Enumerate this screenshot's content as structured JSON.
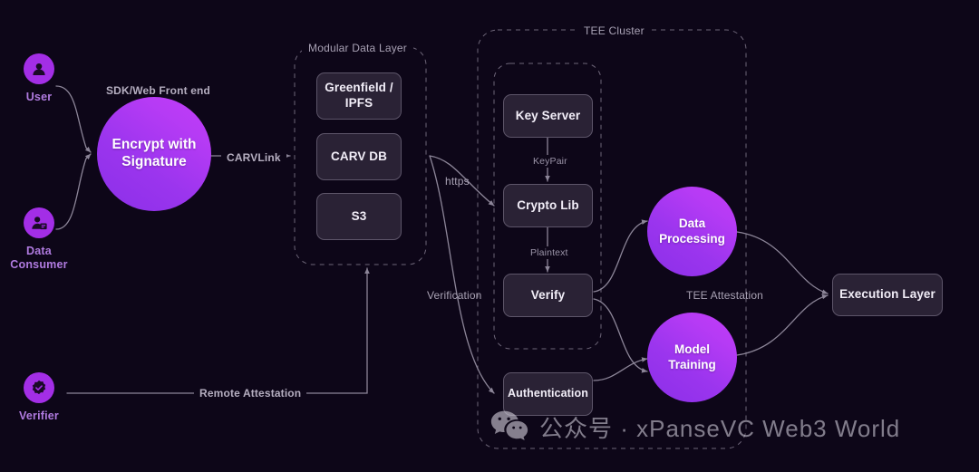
{
  "diagram": {
    "background_color": "#0d0618",
    "accent_color": "#a32ee6",
    "box_fill": "#2a2235",
    "box_border": "#5d5569",
    "edge_color": "#8c8598"
  },
  "actors": [
    {
      "id": "user",
      "label": "User",
      "icon": "user-icon"
    },
    {
      "id": "data_consumer",
      "label": "Data\nConsumer",
      "icon": "data-consumer-icon"
    },
    {
      "id": "verifier",
      "label": "Verifier",
      "icon": "verified-badge-icon"
    }
  ],
  "circles": [
    {
      "id": "encrypt",
      "label": "Encrypt with\nSignature"
    },
    {
      "id": "data_processing",
      "label": "Data\nProcessing"
    },
    {
      "id": "model_training",
      "label": "Model\nTraining"
    }
  ],
  "groups": [
    {
      "id": "modular_data_layer",
      "title": "Modular Data Layer"
    },
    {
      "id": "tee_cluster",
      "title": "TEE Cluster"
    }
  ],
  "modular_data_layer": {
    "title": "Modular Data Layer",
    "nodes": [
      {
        "id": "greenfield",
        "label": "Greenfield /\nIPFS"
      },
      {
        "id": "carvdb",
        "label": "CARV DB"
      },
      {
        "id": "s3",
        "label": "S3"
      }
    ]
  },
  "tee_cluster": {
    "title": "TEE Cluster",
    "inner_nodes": [
      {
        "id": "key_server",
        "label": "Key Server"
      },
      {
        "id": "crypto_lib",
        "label": "Crypto Lib"
      },
      {
        "id": "verify",
        "label": "Verify"
      }
    ],
    "outer_nodes": [
      {
        "id": "authentication",
        "label": "Authentication"
      }
    ]
  },
  "execution": {
    "id": "execution_layer",
    "label": "Execution Layer"
  },
  "edge_labels": {
    "sdk_web_front_end": "SDK/Web Front end",
    "carvlink": "CARVLink",
    "https": "https",
    "verification": "Verification",
    "keypair": "KeyPair",
    "plaintext": "Plaintext",
    "tee_attestation": "TEE Attestation",
    "remote_attestation": "Remote Attestation"
  },
  "watermark": {
    "text": "公众号 · xPanseVC Web3 World",
    "icon": "wechat-icon"
  }
}
